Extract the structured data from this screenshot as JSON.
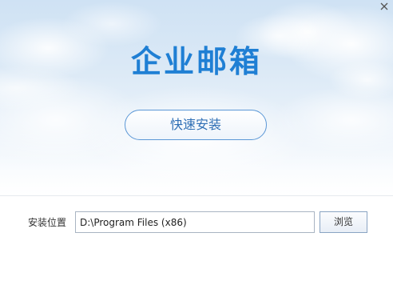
{
  "window": {
    "title": "企业邮箱",
    "close_icon": "close-icon"
  },
  "main": {
    "quick_install_label": "快速安装"
  },
  "install_path": {
    "label": "安装位置",
    "value": "D:\\Program Files (x86)",
    "browse_label": "浏览"
  },
  "colors": {
    "title": "#1f7fd4",
    "button_border": "#5b97d6",
    "button_text": "#2f6fb5"
  }
}
